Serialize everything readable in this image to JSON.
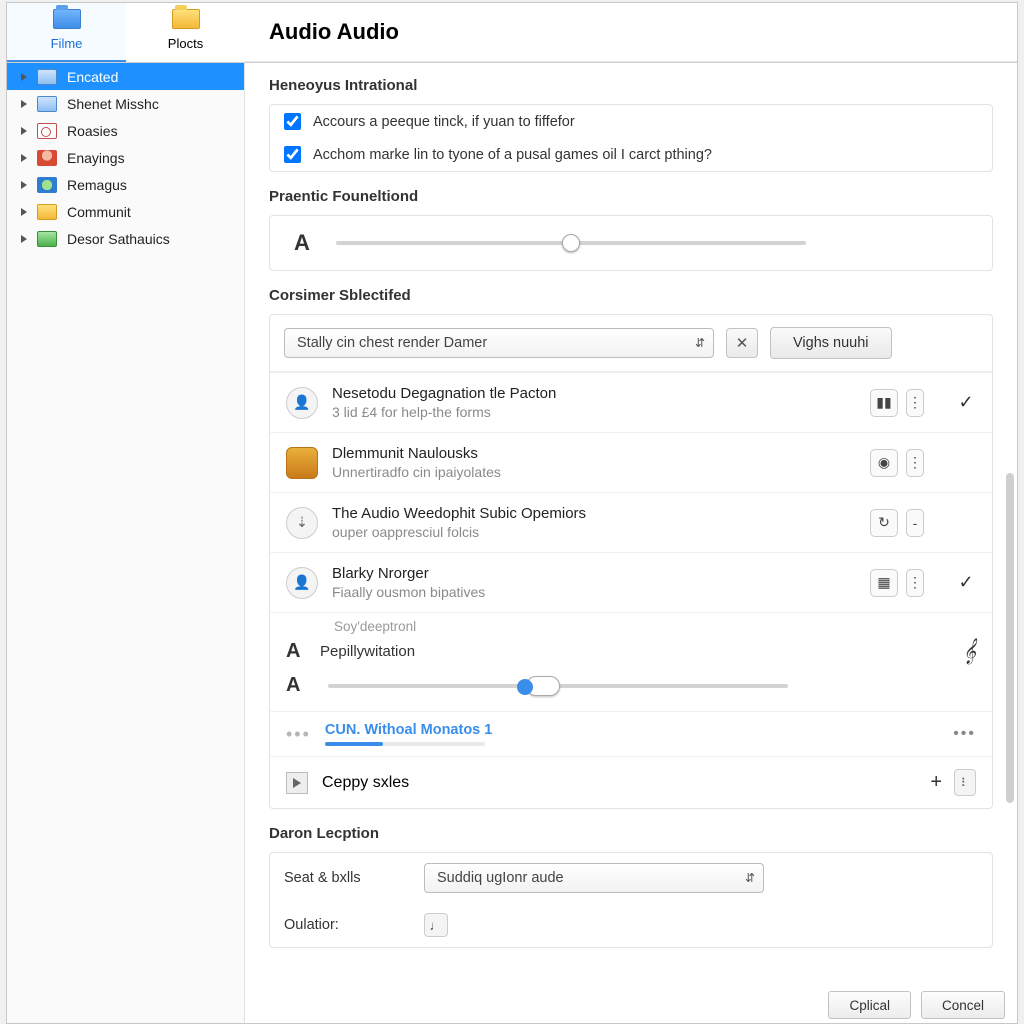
{
  "tabs": {
    "filme": "Filme",
    "plocts": "Plocts"
  },
  "sidebar": {
    "items": [
      {
        "label": "Encated"
      },
      {
        "label": "Shenet Misshc"
      },
      {
        "label": "Roasies"
      },
      {
        "label": "Enayings"
      },
      {
        "label": "Remagus"
      },
      {
        "label": "Communit"
      },
      {
        "label": "Desor Sathauics"
      }
    ]
  },
  "page": {
    "title": "Audio Audio"
  },
  "sections": {
    "intro_h": "Heneoyus Intrational",
    "check1": "Accours a peeque tinck, if yuan to fiffefor",
    "check2": "Acchom marke lin to tyone of a pusal games oil I carct pthing?",
    "font_h": "Praentic Founeltiond",
    "corsimer_h": "Corsimer Sblectifed",
    "combo_value": "Stally cin chest render Damer",
    "btn_vighs": "Vighs nuuhi",
    "daron_h": "Daron Lecption",
    "seat_label": "Seat & bxlls",
    "seat_value": "Suddiq ugIonr aude",
    "oulatior_label": "Oulatior:"
  },
  "list": [
    {
      "title": "Nesetodu Degagnation tle Pacton",
      "sub": "3 lid £4 for help-the forms",
      "avatar": "1",
      "icon": "bars",
      "checked": true
    },
    {
      "title": "Dlemmunit Naulousks",
      "sub": "Unnertiradfo cin ipaiyolates",
      "avatar": "sq",
      "icon": "globe",
      "checked": false
    },
    {
      "title": "The Audio Weedophit Subic Opemiors",
      "sub": "ouper oappresciul folcis",
      "avatar": "3",
      "icon": "arrow",
      "checked": false
    },
    {
      "title": "Blarky Nrorger",
      "sub": "Fiaally ousmon bipatives",
      "avatar": "4",
      "icon": "cal",
      "checked": true
    }
  ],
  "subblock": {
    "hint": "Soy'deeptronl",
    "label": "Pepillywitation"
  },
  "loading": {
    "title": "CUN. Withoal Monatos 1"
  },
  "play": {
    "label": "Ceppy sxles"
  },
  "footer": {
    "ok": "Cplical",
    "cancel": "Concel"
  },
  "font_A": "A"
}
